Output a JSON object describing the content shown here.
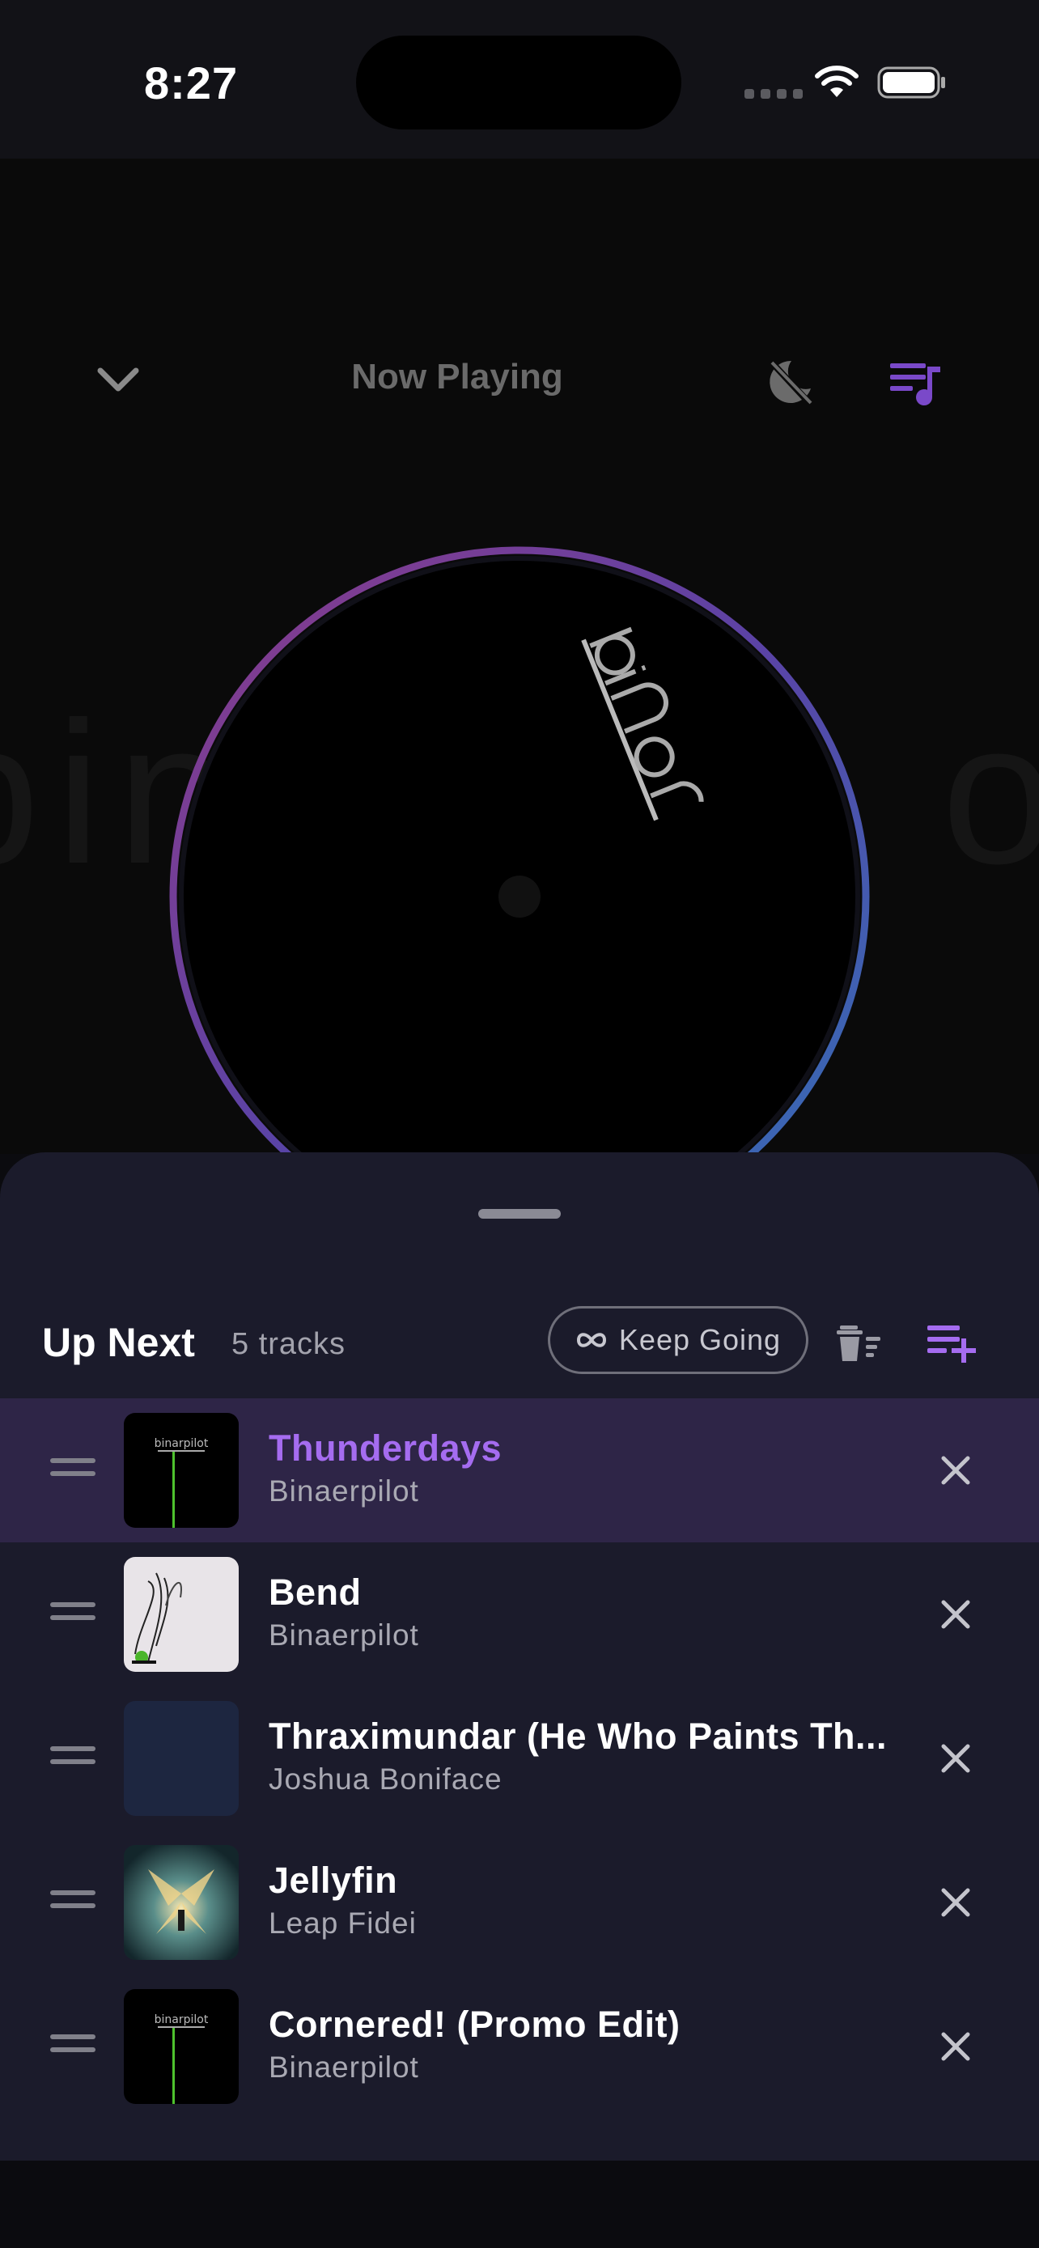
{
  "status_bar": {
    "time": "8:27"
  },
  "background_word": {
    "left": "bin",
    "right": "ot"
  },
  "header": {
    "title": "Now Playing"
  },
  "queue_panel": {
    "heading": "Up Next",
    "track_count": "5 tracks",
    "keep_going_label": "Keep Going"
  },
  "tracks": [
    {
      "title": "Thunderdays",
      "artist": "Binaerpilot",
      "art": "binaerpilot-logo",
      "active": true
    },
    {
      "title": "Bend",
      "artist": "Binaerpilot",
      "art": "bend-art",
      "active": false
    },
    {
      "title": "Thraximundar (He Who Paints Th...",
      "artist": "Joshua Boniface",
      "art": "placeholder-art",
      "active": false
    },
    {
      "title": "Jellyfin",
      "artist": "Leap Fidei",
      "art": "jellyfin-art",
      "active": false
    },
    {
      "title": "Cornered! (Promo Edit)",
      "artist": "Binaerpilot",
      "art": "binaerpilot-logo",
      "active": false
    }
  ],
  "colors": {
    "accent": "#a56cf0",
    "sheet": "#1b1b2b",
    "active_row": "#2e2547",
    "ring_gradient": [
      "#8c3a8a",
      "#5a43a6",
      "#2f72b8"
    ]
  }
}
